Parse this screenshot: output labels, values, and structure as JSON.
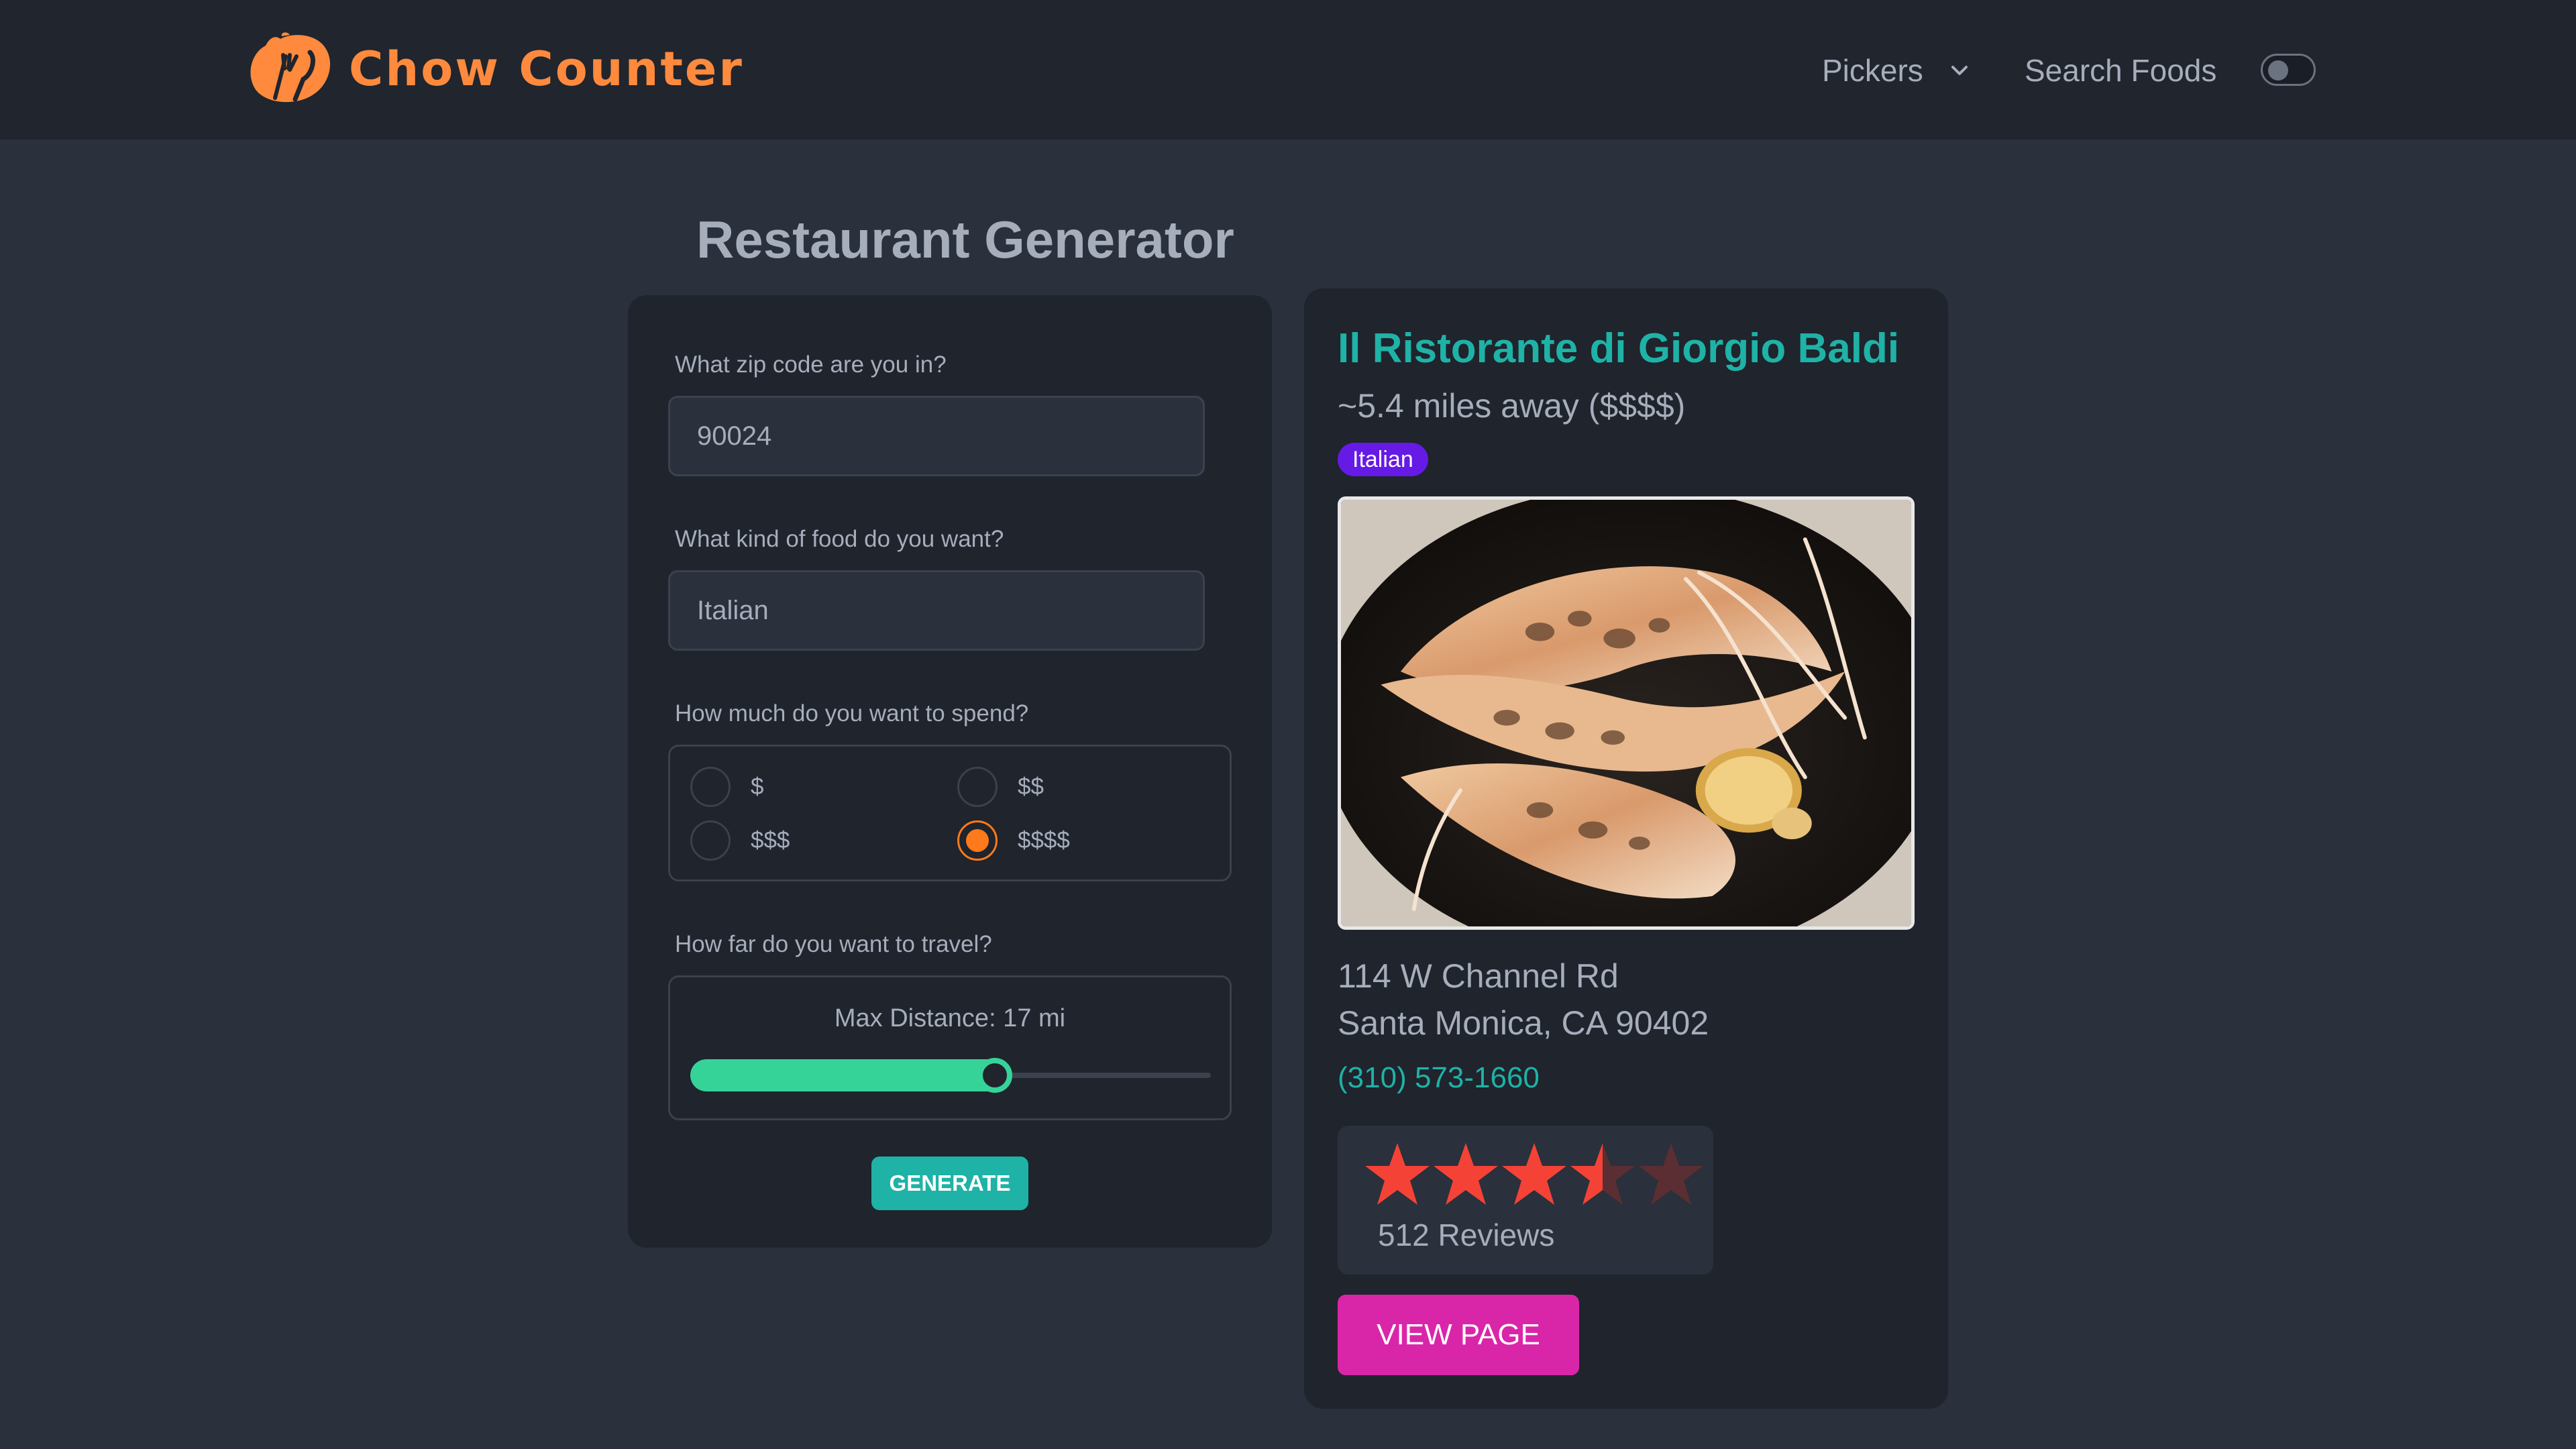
{
  "brand": {
    "name": "Chow Counter",
    "accent": "#ff8a3d"
  },
  "nav": {
    "pickers_label": "Pickers",
    "search_label": "Search Foods",
    "theme_toggle": false
  },
  "page": {
    "title": "Restaurant Generator"
  },
  "form": {
    "zip": {
      "label": "What zip code are you in?",
      "value": "90024"
    },
    "food": {
      "label": "What kind of food do you want?",
      "value": "Italian"
    },
    "price": {
      "label": "How much do you want to spend?",
      "options": [
        "$",
        "$$",
        "$$$",
        "$$$$"
      ],
      "selected": "$$$$"
    },
    "distance": {
      "label": "How far do you want to travel?",
      "text": "Max Distance: 17 mi",
      "value": 17,
      "max": 25
    },
    "generate_label": "GENERATE"
  },
  "result": {
    "name": "Il Ristorante di Giorgio Baldi",
    "distance_price": "~5.4 miles away ($$$$)",
    "cuisine": "Italian",
    "image_alt": "grilled-langoustines-photo",
    "address_line1": "114 W Channel Rd",
    "address_line2": "Santa Monica, CA 90402",
    "phone": "(310) 573-1660",
    "rating": 3.5,
    "rating_max": 5,
    "reviews": "512 Reviews",
    "view_label": "VIEW PAGE"
  },
  "colors": {
    "primary": "#1fb2a6",
    "secondary": "#d926a9",
    "accent_orange": "#ff7a1a",
    "success": "#36d399",
    "badge": "#661ae6",
    "star": "#f44336"
  }
}
